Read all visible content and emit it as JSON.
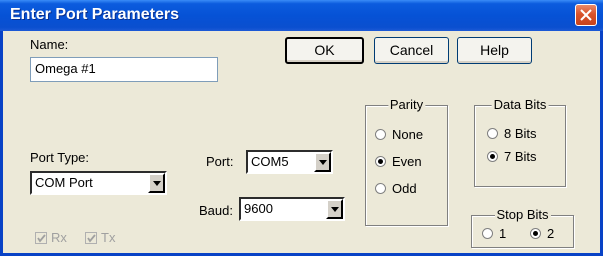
{
  "window": {
    "title": "Enter Port Parameters"
  },
  "name_field": {
    "label": "Name:",
    "value": "Omega #1"
  },
  "buttons": {
    "ok": "OK",
    "cancel": "Cancel",
    "help": "Help"
  },
  "port_type": {
    "label": "Port Type:",
    "value": "COM Port"
  },
  "port": {
    "label": "Port:",
    "value": "COM5"
  },
  "baud": {
    "label": "Baud:",
    "value": "9600"
  },
  "parity": {
    "title": "Parity",
    "options": [
      "None",
      "Even",
      "Odd"
    ],
    "selected": "Even"
  },
  "data_bits": {
    "title": "Data Bits",
    "options": [
      "8 Bits",
      "7 Bits"
    ],
    "selected": "7 Bits"
  },
  "stop_bits": {
    "title": "Stop Bits",
    "options": [
      "1",
      "2"
    ],
    "selected": "2"
  },
  "flow": {
    "rx": {
      "label": "Rx",
      "checked": true,
      "enabled": false
    },
    "tx": {
      "label": "Tx",
      "checked": true,
      "enabled": false
    }
  },
  "colors": {
    "titlebar": "#0652d6",
    "window_bg": "#ece9d8",
    "close": "#d9532b"
  }
}
